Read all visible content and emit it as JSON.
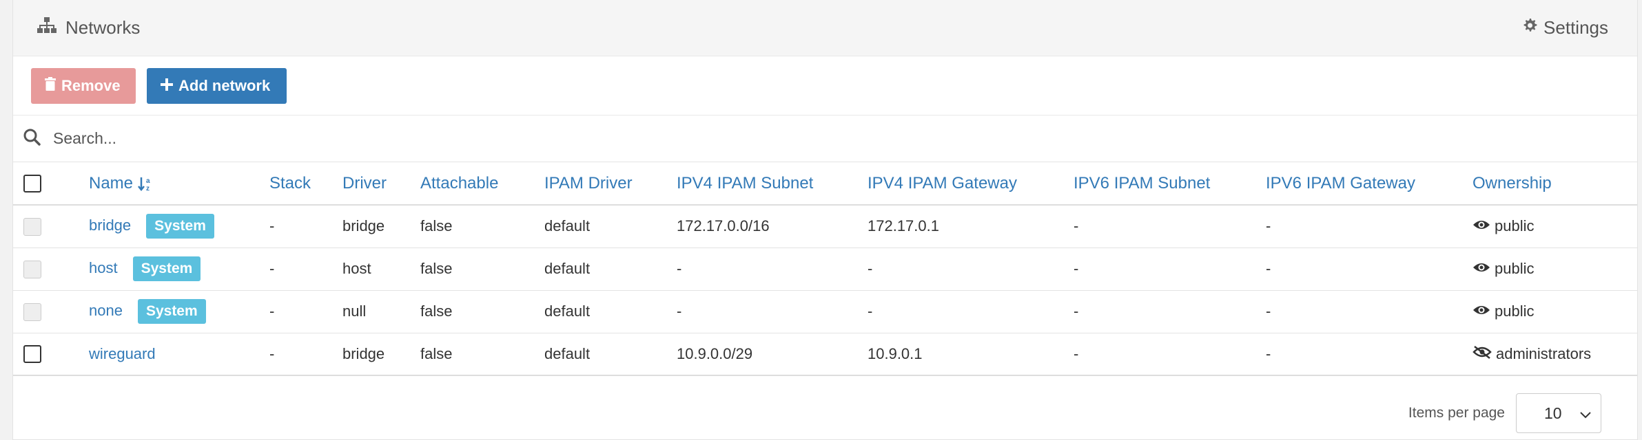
{
  "header": {
    "title": "Networks",
    "settings_label": "Settings",
    "title_icon": "sitemap-icon",
    "settings_icon": "gear-icon"
  },
  "actions": {
    "remove_label": "Remove",
    "add_label": "Add network"
  },
  "search": {
    "placeholder": "Search..."
  },
  "table": {
    "columns": [
      "Name",
      "Stack",
      "Driver",
      "Attachable",
      "IPAM Driver",
      "IPV4 IPAM Subnet",
      "IPV4 IPAM Gateway",
      "IPV6 IPAM Subnet",
      "IPV6 IPAM Gateway",
      "Ownership"
    ],
    "system_badge": "System",
    "rows": [
      {
        "name": "bridge",
        "system": true,
        "stack": "-",
        "driver": "bridge",
        "attachable": "false",
        "ipam_driver": "default",
        "ipv4_subnet": "172.17.0.0/16",
        "ipv4_gateway": "172.17.0.1",
        "ipv6_subnet": "-",
        "ipv6_gateway": "-",
        "ownership": "public"
      },
      {
        "name": "host",
        "system": true,
        "stack": "-",
        "driver": "host",
        "attachable": "false",
        "ipam_driver": "default",
        "ipv4_subnet": "-",
        "ipv4_gateway": "-",
        "ipv6_subnet": "-",
        "ipv6_gateway": "-",
        "ownership": "public"
      },
      {
        "name": "none",
        "system": true,
        "stack": "-",
        "driver": "null",
        "attachable": "false",
        "ipam_driver": "default",
        "ipv4_subnet": "-",
        "ipv4_gateway": "-",
        "ipv6_subnet": "-",
        "ipv6_gateway": "-",
        "ownership": "public"
      },
      {
        "name": "wireguard",
        "system": false,
        "stack": "-",
        "driver": "bridge",
        "attachable": "false",
        "ipam_driver": "default",
        "ipv4_subnet": "10.9.0.0/29",
        "ipv4_gateway": "10.9.0.1",
        "ipv6_subnet": "-",
        "ipv6_gateway": "-",
        "ownership": "administrators"
      }
    ]
  },
  "footer": {
    "items_per_page_label": "Items per page",
    "items_per_page_value": "10"
  },
  "colors": {
    "primary": "#337ab7",
    "danger_disabled": "#e79a9a",
    "info": "#5bc0de"
  }
}
